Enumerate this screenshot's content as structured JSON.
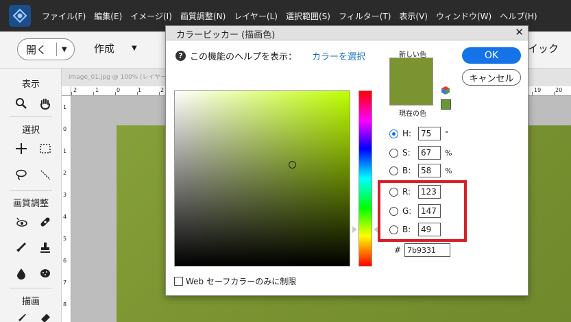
{
  "app": {
    "logo_icon": "photoshop-elements-icon",
    "menu": [
      "ファイル(F)",
      "編集(E)",
      "イメージ(I)",
      "画質調整(N)",
      "レイヤー(L)",
      "選択範囲(S)",
      "フィルター(T)",
      "表示(V)",
      "ウィンドウ(W)",
      "ヘルプ(H)"
    ]
  },
  "options_bar": {
    "open_label": "開く",
    "create_label": "作成",
    "quick_fragment": "イック"
  },
  "tools": {
    "view_label": "表示",
    "select_label": "選択",
    "enhance_label": "画質調整",
    "draw_label": "描画"
  },
  "document": {
    "tab_title": "image_01.jpg @ 100% (レイヤー",
    "hruler_numbers": [
      "2",
      "1",
      "0",
      "1",
      "2",
      "19",
      "20"
    ],
    "vruler_numbers": [
      "1",
      "0",
      "1",
      "2",
      "3",
      "4",
      "5",
      "6",
      "7",
      "8"
    ]
  },
  "dialog": {
    "title": "カラーピッカー (描画色)",
    "help_text": "この機能のヘルプを表示：",
    "help_link": "カラーを選択",
    "new_label": "新しい色",
    "current_label": "現在の色",
    "ok_label": "OK",
    "cancel_label": "キャンセル",
    "hue_deg": 75,
    "fields": {
      "H": {
        "label": "H:",
        "value": "75",
        "unit": "°",
        "selected": true
      },
      "S": {
        "label": "S:",
        "value": "67",
        "unit": "%",
        "selected": false
      },
      "B": {
        "label": "B:",
        "value": "58",
        "unit": "%",
        "selected": false
      },
      "R": {
        "label": "R:",
        "value": "123",
        "selected": false
      },
      "G": {
        "label": "G:",
        "value": "147",
        "selected": false
      },
      "Bl": {
        "label": "B:",
        "value": "49",
        "selected": false
      }
    },
    "hex_hash": "#",
    "hex_value": "7b9331",
    "websafe_label": "Web セーフカラーのみに制限",
    "websafe_checked": false
  },
  "colors": {
    "selected": "#7b9331",
    "accent": "#1473e6",
    "highlight": "#d4202a"
  }
}
